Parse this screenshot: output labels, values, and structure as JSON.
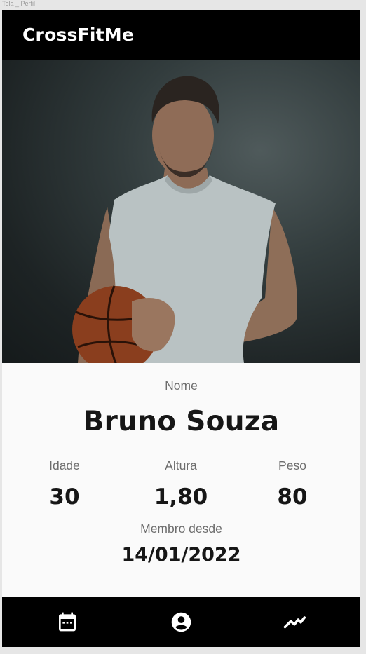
{
  "frame": {
    "label": "Tela _ Perfil"
  },
  "app_bar": {
    "title": "CrossFitMe"
  },
  "profile": {
    "name_label": "Nome",
    "name": "Bruno Souza",
    "age_label": "Idade",
    "age": "30",
    "height_label": "Altura",
    "height": "1,80",
    "weight_label": "Peso",
    "weight": "80",
    "member_since_label": "Membro desde",
    "member_since": "14/01/2022"
  },
  "bottom_nav": {
    "items": [
      {
        "icon": "calendar-icon"
      },
      {
        "icon": "account-circle-icon"
      },
      {
        "icon": "trending-up-icon"
      }
    ]
  },
  "colors": {
    "app_bar_bg": "#000000",
    "page_bg": "#fafafa",
    "label_text": "#6d6d6d",
    "value_text": "#161616"
  }
}
